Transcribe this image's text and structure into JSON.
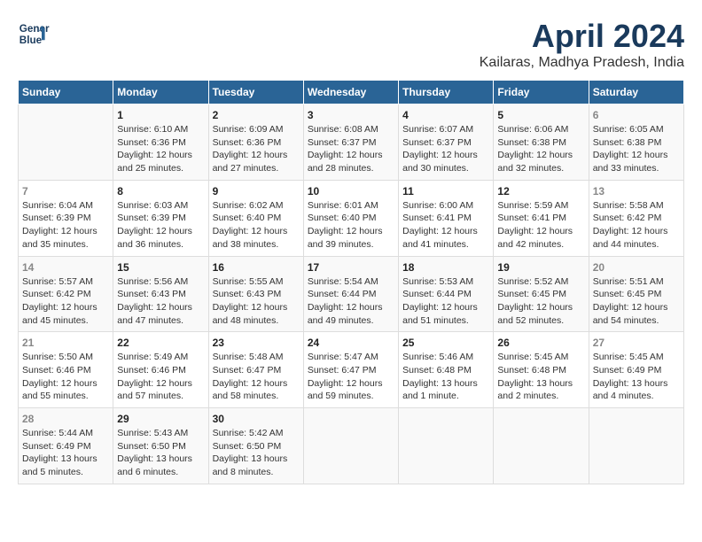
{
  "header": {
    "logo_line1": "General",
    "logo_line2": "Blue",
    "title": "April 2024",
    "subtitle": "Kailaras, Madhya Pradesh, India"
  },
  "calendar": {
    "days_of_week": [
      "Sunday",
      "Monday",
      "Tuesday",
      "Wednesday",
      "Thursday",
      "Friday",
      "Saturday"
    ],
    "weeks": [
      [
        {
          "day": "",
          "info": ""
        },
        {
          "day": "1",
          "info": "Sunrise: 6:10 AM\nSunset: 6:36 PM\nDaylight: 12 hours\nand 25 minutes."
        },
        {
          "day": "2",
          "info": "Sunrise: 6:09 AM\nSunset: 6:36 PM\nDaylight: 12 hours\nand 27 minutes."
        },
        {
          "day": "3",
          "info": "Sunrise: 6:08 AM\nSunset: 6:37 PM\nDaylight: 12 hours\nand 28 minutes."
        },
        {
          "day": "4",
          "info": "Sunrise: 6:07 AM\nSunset: 6:37 PM\nDaylight: 12 hours\nand 30 minutes."
        },
        {
          "day": "5",
          "info": "Sunrise: 6:06 AM\nSunset: 6:38 PM\nDaylight: 12 hours\nand 32 minutes."
        },
        {
          "day": "6",
          "info": "Sunrise: 6:05 AM\nSunset: 6:38 PM\nDaylight: 12 hours\nand 33 minutes."
        }
      ],
      [
        {
          "day": "7",
          "info": "Sunrise: 6:04 AM\nSunset: 6:39 PM\nDaylight: 12 hours\nand 35 minutes."
        },
        {
          "day": "8",
          "info": "Sunrise: 6:03 AM\nSunset: 6:39 PM\nDaylight: 12 hours\nand 36 minutes."
        },
        {
          "day": "9",
          "info": "Sunrise: 6:02 AM\nSunset: 6:40 PM\nDaylight: 12 hours\nand 38 minutes."
        },
        {
          "day": "10",
          "info": "Sunrise: 6:01 AM\nSunset: 6:40 PM\nDaylight: 12 hours\nand 39 minutes."
        },
        {
          "day": "11",
          "info": "Sunrise: 6:00 AM\nSunset: 6:41 PM\nDaylight: 12 hours\nand 41 minutes."
        },
        {
          "day": "12",
          "info": "Sunrise: 5:59 AM\nSunset: 6:41 PM\nDaylight: 12 hours\nand 42 minutes."
        },
        {
          "day": "13",
          "info": "Sunrise: 5:58 AM\nSunset: 6:42 PM\nDaylight: 12 hours\nand 44 minutes."
        }
      ],
      [
        {
          "day": "14",
          "info": "Sunrise: 5:57 AM\nSunset: 6:42 PM\nDaylight: 12 hours\nand 45 minutes."
        },
        {
          "day": "15",
          "info": "Sunrise: 5:56 AM\nSunset: 6:43 PM\nDaylight: 12 hours\nand 47 minutes."
        },
        {
          "day": "16",
          "info": "Sunrise: 5:55 AM\nSunset: 6:43 PM\nDaylight: 12 hours\nand 48 minutes."
        },
        {
          "day": "17",
          "info": "Sunrise: 5:54 AM\nSunset: 6:44 PM\nDaylight: 12 hours\nand 49 minutes."
        },
        {
          "day": "18",
          "info": "Sunrise: 5:53 AM\nSunset: 6:44 PM\nDaylight: 12 hours\nand 51 minutes."
        },
        {
          "day": "19",
          "info": "Sunrise: 5:52 AM\nSunset: 6:45 PM\nDaylight: 12 hours\nand 52 minutes."
        },
        {
          "day": "20",
          "info": "Sunrise: 5:51 AM\nSunset: 6:45 PM\nDaylight: 12 hours\nand 54 minutes."
        }
      ],
      [
        {
          "day": "21",
          "info": "Sunrise: 5:50 AM\nSunset: 6:46 PM\nDaylight: 12 hours\nand 55 minutes."
        },
        {
          "day": "22",
          "info": "Sunrise: 5:49 AM\nSunset: 6:46 PM\nDaylight: 12 hours\nand 57 minutes."
        },
        {
          "day": "23",
          "info": "Sunrise: 5:48 AM\nSunset: 6:47 PM\nDaylight: 12 hours\nand 58 minutes."
        },
        {
          "day": "24",
          "info": "Sunrise: 5:47 AM\nSunset: 6:47 PM\nDaylight: 12 hours\nand 59 minutes."
        },
        {
          "day": "25",
          "info": "Sunrise: 5:46 AM\nSunset: 6:48 PM\nDaylight: 13 hours\nand 1 minute."
        },
        {
          "day": "26",
          "info": "Sunrise: 5:45 AM\nSunset: 6:48 PM\nDaylight: 13 hours\nand 2 minutes."
        },
        {
          "day": "27",
          "info": "Sunrise: 5:45 AM\nSunset: 6:49 PM\nDaylight: 13 hours\nand 4 minutes."
        }
      ],
      [
        {
          "day": "28",
          "info": "Sunrise: 5:44 AM\nSunset: 6:49 PM\nDaylight: 13 hours\nand 5 minutes."
        },
        {
          "day": "29",
          "info": "Sunrise: 5:43 AM\nSunset: 6:50 PM\nDaylight: 13 hours\nand 6 minutes."
        },
        {
          "day": "30",
          "info": "Sunrise: 5:42 AM\nSunset: 6:50 PM\nDaylight: 13 hours\nand 8 minutes."
        },
        {
          "day": "",
          "info": ""
        },
        {
          "day": "",
          "info": ""
        },
        {
          "day": "",
          "info": ""
        },
        {
          "day": "",
          "info": ""
        }
      ]
    ]
  }
}
